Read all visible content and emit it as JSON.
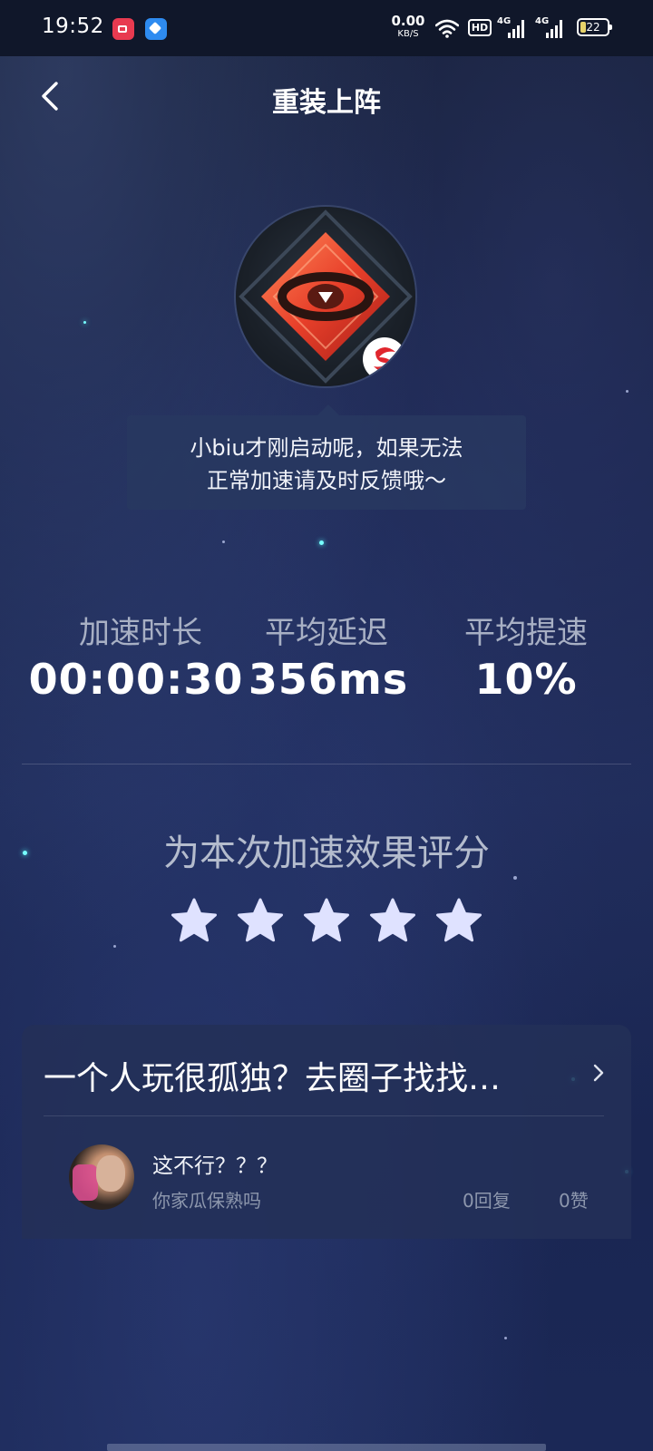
{
  "status_bar": {
    "time": "19:52",
    "net_speed_value": "0.00",
    "net_speed_unit": "KB/S",
    "hd_label": "HD",
    "signal_1_label": "4G",
    "signal_2_label": "4G",
    "battery": "22",
    "battery_level": 0.22,
    "icons": [
      "video-app-icon",
      "messenger-app-icon",
      "wifi-icon",
      "hd-voice-icon",
      "signal-4g-icon",
      "signal-4g-icon",
      "battery-icon"
    ]
  },
  "header": {
    "title": "重装上阵",
    "back_icon": "chevron-left-icon"
  },
  "game": {
    "logo_icon": "game-logo",
    "badge_icon": "netease-badge-icon"
  },
  "tooltip": {
    "line1": "小biu才刚启动呢，如果无法",
    "line2": "正常加速请及时反馈哦～"
  },
  "stats": [
    {
      "label": "加速时长",
      "value": "00:00:30"
    },
    {
      "label": "平均延迟",
      "value": "356ms"
    },
    {
      "label": "平均提速",
      "value": "10%"
    }
  ],
  "rating": {
    "title": "为本次加速效果评分",
    "max_stars": 5,
    "star_color": "#dfe2ff"
  },
  "community": {
    "title": "一个人玩很孤独？去圈子找找…",
    "arrow_icon": "chevron-right-icon",
    "post": {
      "title": "这不行？？？",
      "subtitle": "你家瓜保熟吗",
      "replies": "0回复",
      "likes": "0赞"
    }
  },
  "colors": {
    "background": "#1b2856",
    "accent_glow": "#55ffff",
    "logo_red": "#ef5a3a"
  }
}
